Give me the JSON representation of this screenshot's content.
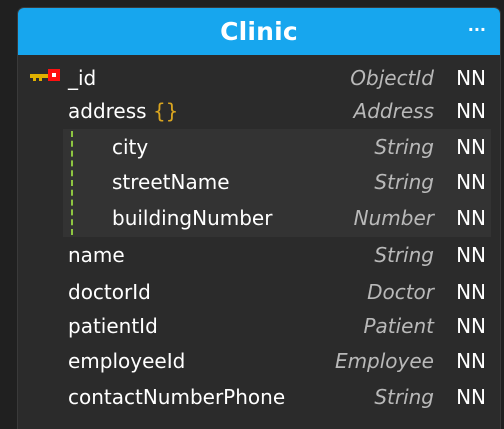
{
  "entity": {
    "title": "Clinic",
    "menu": "···",
    "fields": [
      {
        "name": "_id",
        "type": "ObjectId",
        "nn": "NN"
      },
      {
        "name": "address",
        "brace": "{}",
        "type": "Address",
        "nn": "NN"
      },
      {
        "name": "city",
        "type": "String",
        "nn": "NN"
      },
      {
        "name": "streetName",
        "type": "String",
        "nn": "NN"
      },
      {
        "name": "buildingNumber",
        "type": "Number",
        "nn": "NN"
      },
      {
        "name": "name",
        "type": "String",
        "nn": "NN"
      },
      {
        "name": "doctorId",
        "type": "Doctor",
        "nn": "NN"
      },
      {
        "name": "patientId",
        "type": "Patient",
        "nn": "NN"
      },
      {
        "name": "employeeId",
        "type": "Employee",
        "nn": "NN"
      },
      {
        "name": "contactNumberPhone",
        "type": "String",
        "nn": "NN"
      }
    ]
  },
  "colors": {
    "header": "#17a6ee",
    "brace": "#d9a520",
    "nested_line": "#8ec641",
    "key": "#ff0000"
  },
  "icons": {
    "primary_key": "key-icon"
  }
}
